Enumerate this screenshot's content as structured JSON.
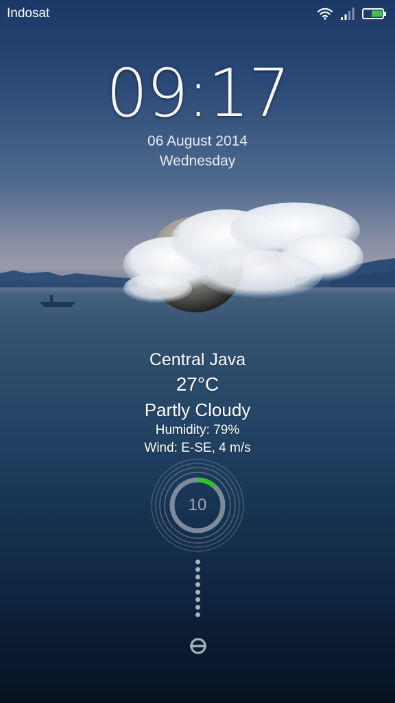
{
  "status_bar": {
    "carrier": "Indosat",
    "icons": [
      "wifi-icon",
      "signal-icon",
      "battery-icon"
    ],
    "battery_color": "#3ec24a"
  },
  "lockscreen": {
    "time": "09:17",
    "date": "06 August 2014",
    "weekday": "Wednesday"
  },
  "weather": {
    "location": "Central Java",
    "temperature": "27°C",
    "condition": "Partly Cloudy",
    "humidity": "Humidity: 79%",
    "wind": "Wind: E-SE, 4 m/s",
    "icon": "moon-cloud-icon"
  },
  "unlock": {
    "count": "10",
    "progress_fraction": 0.12,
    "accent_color": "#2fc02f",
    "icon": "unlock-icon"
  }
}
